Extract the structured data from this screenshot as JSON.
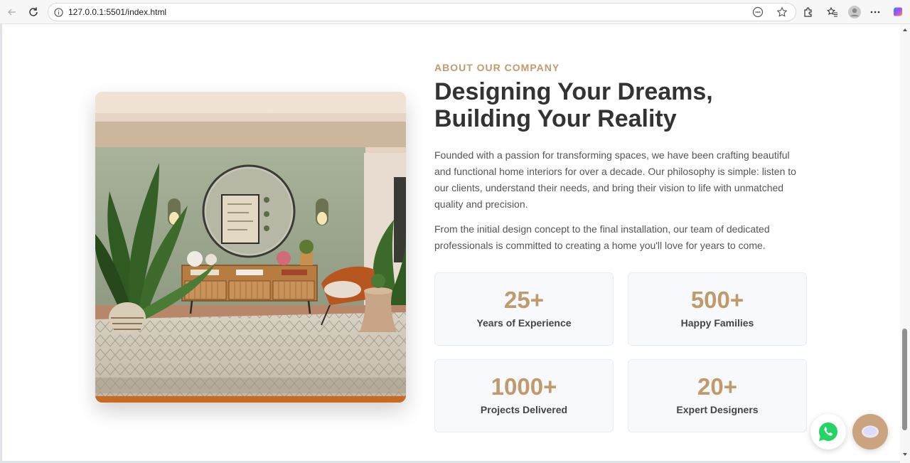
{
  "browser": {
    "url": "127.0.0.1:5501/index.html"
  },
  "about": {
    "eyebrow": "ABOUT OUR COMPANY",
    "heading": "Designing Your Dreams, Building Your Reality",
    "paragraph1": "Founded with a passion for transforming spaces, we have been crafting beautiful and functional home interiors for over a decade. Our philosophy is simple: listen to our clients, understand their needs, and bring their vision to life with unmatched quality and precision.",
    "paragraph2": "From the initial design concept to the final installation, our team of dedicated professionals is committed to creating a home you'll love for years to come."
  },
  "stats": [
    {
      "value": "25+",
      "label": "Years of Experience"
    },
    {
      "value": "500+",
      "label": "Happy Families"
    },
    {
      "value": "1000+",
      "label": "Projects Delivered"
    },
    {
      "value": "20+",
      "label": "Expert Designers"
    }
  ],
  "colors": {
    "accent": "#c19a6b",
    "heading": "#333333",
    "body": "#555555",
    "stat_bg": "#f7f9fc",
    "whatsapp": "#25d366"
  },
  "icons": {
    "back": "arrow-left-icon",
    "reload": "reload-icon",
    "info": "info-icon",
    "reader": "reader-icon",
    "favorite": "star-icon",
    "extensions": "puzzle-icon",
    "favorites": "favorites-icon",
    "profile": "avatar-icon",
    "menu": "more-icon",
    "copilot": "copilot-icon",
    "whatsapp": "whatsapp-icon",
    "chat": "chat-icon"
  }
}
